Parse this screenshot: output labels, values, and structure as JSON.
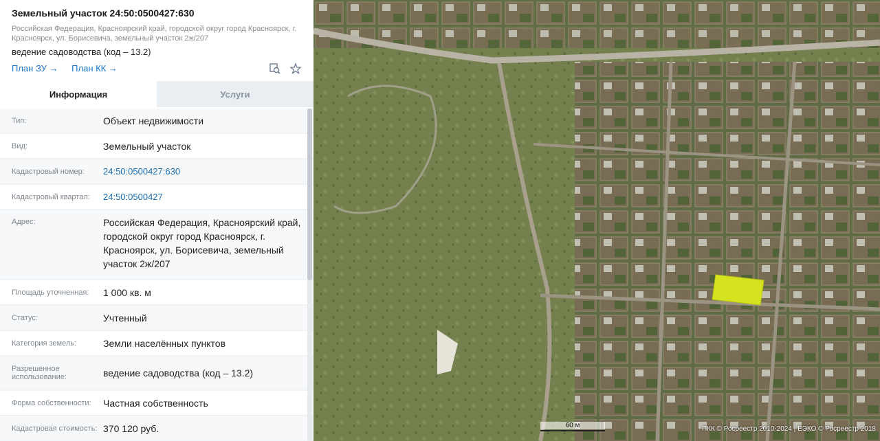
{
  "header": {
    "title": "Земельный участок 24:50:0500427:630",
    "address_short": "Российская Федерация, Красноярский край, городской округ город Красноярск, г. Красноярск, ул. Борисевича, земельный участок 2ж/207",
    "usage": "ведение садоводства (код – 13.2)",
    "plan_zu": "План ЗУ →",
    "plan_kk": "План КК →"
  },
  "tabs": [
    {
      "label": "Информация"
    },
    {
      "label": "Услуги"
    }
  ],
  "rows": [
    {
      "label": "Тип:",
      "value": "Объект недвижимости"
    },
    {
      "label": "Вид:",
      "value": "Земельный участок"
    },
    {
      "label": "Кадастровый номер:",
      "value": "24:50:0500427:630"
    },
    {
      "label": "Кадастровый квартал:",
      "value": "24:50:0500427"
    },
    {
      "label": "Адрес:",
      "value": "Российская Федерация, Красноярский край, городской округ город Красноярск, г. Красноярск, ул. Борисевича, земельный участок 2ж/207"
    },
    {
      "label": "Площадь уточненная:",
      "value": "1 000 кв. м"
    },
    {
      "label": "Статус:",
      "value": "Учтенный"
    },
    {
      "label": "Категория земель:",
      "value": "Земли населённых пунктов"
    },
    {
      "label": "Разрешенное использование:",
      "value": "ведение садоводства (код – 13.2)"
    },
    {
      "label": "Форма собственности:",
      "value": "Частная собственность"
    },
    {
      "label": "Кадастровая стоимость:",
      "value": "370 120 руб."
    }
  ],
  "map": {
    "scale_label": "60 м",
    "attribution": "ПКК © Росреестр 2010-2024 | ЕЭКО © Росреестр 2018"
  },
  "colors": {
    "link": "#1a73c7",
    "parcel_highlight": "#d4e21f"
  }
}
